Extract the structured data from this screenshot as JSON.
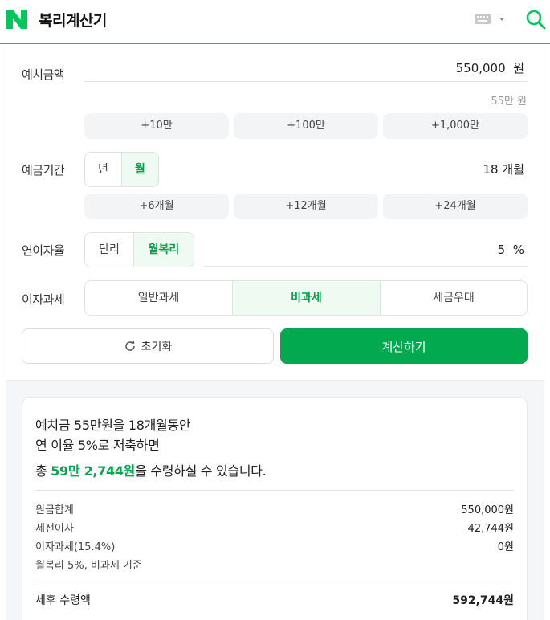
{
  "header": {
    "title": "복리계산기",
    "brand_color": "#03c75a",
    "icons": [
      "naver-logo-icon",
      "keyboard-icon",
      "search-icon"
    ]
  },
  "deposit": {
    "label": "예치금액",
    "value": "550,000",
    "unit": "원",
    "hint": "55만 원",
    "chips": [
      "+10만",
      "+100만",
      "+1,000만"
    ]
  },
  "period": {
    "label": "예금기간",
    "toggle": [
      "년",
      "월"
    ],
    "selected": "월",
    "value": "18",
    "unit": "개월",
    "chips": [
      "+6개월",
      "+12개월",
      "+24개월"
    ]
  },
  "rate": {
    "label": "연이자율",
    "toggle": [
      "단리",
      "월복리"
    ],
    "selected": "월복리",
    "value": "5",
    "unit": "%"
  },
  "tax": {
    "label": "이자과세",
    "options": [
      "일반과세",
      "비과세",
      "세금우대"
    ],
    "selected": "비과세"
  },
  "actions": {
    "reset_label": "초기화",
    "calc_label": "계산하기"
  },
  "result": {
    "line1": "예치금 55만원을 18개월동안",
    "line2": "연 이율 5%로 저축하면",
    "line3_prefix": "총 ",
    "line3_amount": "59만 2,744원",
    "line3_suffix": "을 수령하실 수 있습니다.",
    "rows": [
      {
        "label": "원금합계",
        "value": "550,000원"
      },
      {
        "label": "세전이자",
        "value": "42,744원"
      },
      {
        "label": "이자과세(15.4%)",
        "value": "0원"
      }
    ],
    "basis": "월복리 5%, 비과세 기준",
    "final_label": "세후 수령액",
    "final_value": "592,744원"
  }
}
